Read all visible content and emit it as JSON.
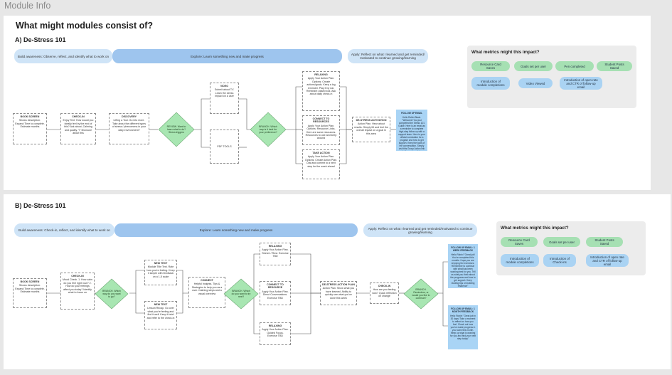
{
  "window": {
    "title": "Module Info"
  },
  "page": {
    "heading": "What might modules consist of?"
  },
  "sectionA": {
    "label": "A) De-Stress 101",
    "phases": {
      "build": "Build awareness: Observe, reflect, and identify what to work on",
      "explore": "Explore: Learn something new and make progress",
      "apply": "Apply: Reflect on what I learned and get reminded/ motivated to continue growing/learning"
    },
    "nodes": {
      "book": {
        "title": "BOOK SCREEN",
        "body": "Shows description. Expand Time to complete. Estimate months"
      },
      "checkin": {
        "title": "CHECK-IN",
        "body": "Enjoy Text. How would you ideally feel by the end of this? Ask about, Calming and quality. \"I\" Ill/unsure about this"
      },
      "doc": {
        "title": "DISCOVERY",
        "body": "Lifting a Tool. Go into more. Take about the different types of stress / phenomena in your daily environment?"
      },
      "video": {
        "title": "VIDEO",
        "body": "Submit about TV. Learn the stress impact on a user"
      },
      "placeholder": "PDF TOOLS",
      "relaxing": {
        "title": "RELAXING",
        "body": "Apply Your Action Plan. Options: Create actions/goals. Keep a log reminder. Play it by ear. Reminder-based tool. Ask about daily check-in"
      },
      "connect": {
        "title": "CONNECT TO RESOURCES",
        "body": "Apply Your Action Plan. Options: Resource Links. Here are some resources. Resources to use and keep around"
      },
      "take": {
        "title": "TAKE ACTION",
        "body": "Apply Your Action Plan. Options: Create Action Plan. Dial and commit to a next step for the week ahead"
      },
      "destress": {
        "title": "DE-STRESS ACTIVATION",
        "body": "Action Plan. Hear about results. Simply lift and feel the overall impact on a goal in this area"
      }
    },
    "diamonds": {
      "d1": "REVIEW. Want to learn what to do? Stress triggers",
      "d2": "BRANCH. Which way is it best for your preference?"
    },
    "sticky": {
      "title": "FOLLOW UP EMAIL",
      "body": "Hello Robin Black. \"Welcome! You just completed the Stress 101 Guide. Here is an email as a reminder to complete high-stay follow up with a support team. Here is your official nomination for a program and how to get support. Keep the tools of the conversation. Simply visit this Group Action link in the next week to complete more\""
    },
    "metrics": {
      "title": "What metrics might this impact?",
      "items": [
        "Resource Card Saves",
        "Goals set per user",
        "Pen completed",
        "Student Posts Saved",
        "Introduction of module completions",
        "Video Viewed",
        "Introduction of open rate and CTR of follow-up email"
      ]
    }
  },
  "sectionB": {
    "label": "B) De-Stress 101",
    "phases": {
      "build": "Build awareness: Check-in, reflect, and identify what to work on",
      "explore": "Explore: Learn something new and make progress",
      "apply": "Apply: Reflect on what I learned and get reminded/motivated to continue growing/learning"
    },
    "nodes": {
      "book": {
        "title": "BOOK SCREEN",
        "body": "Shows description. Expand Time to complete. Estimate months"
      },
      "checkin": {
        "title": "CHECK-IN",
        "body": "Mood Check. 1. How calm do you feel right now? 2. How do your feelings affect you today? Identify what to focus on"
      },
      "new1": {
        "title": "NEW TEXT",
        "body": "Module Title Text. Rate how you're feeling. Keep it simple with feedback on a 1-5 scale"
      },
      "new2": {
        "title": "NEW TEXT",
        "body": "Lesson Recap. Go over what you're feeling and find it well. Keep it brief and refer to the check-in"
      },
      "connect1": {
        "title": "CONNECT",
        "body": "Helpful Insights. Tips & Strategies to help you as a user. Calming steps and a visual overview"
      },
      "opt1": {
        "title": "RELAXING",
        "body": "Apply Your Action Plan. Stretch / Rest. Exercise TBD"
      },
      "opt2": {
        "title": "CONNECT TO RESOURCE",
        "body": "Apply Your Action Plan. Direct Conversations. Exercise TBD"
      },
      "opt3": {
        "title": "RELAXING",
        "body": "Apply Your Action Plan. Guided Focus. Exercise TBD"
      },
      "destress": {
        "title": "DE-STRESS ACTION PLAN",
        "body": "Action Plan. Show what you have learned. Ability to quickly see what you've done this week"
      },
      "checkout": {
        "title": "CHECK-IN",
        "body": "How are you feeling now? Quick reflection on change"
      }
    },
    "diamonds": {
      "d1": "BRANCH. Which way do you want to go?",
      "d2": "BRANCH. Which do you want to try next?",
      "d3": "BRANCH. Reminders, or would you like to continue?"
    },
    "stickies": [
      {
        "title": "FOLLOW UP EMAIL: 1 WEEK FEEDBACK",
        "body": "Hello Robin! \"Great job! You've completed this module. Hope you are enjoying the exercises. Remember to continue with what has been working best for you. Tell us what you think about the programs and how to get support. Keep reading tips on building resilience\""
      },
      {
        "title": "FOLLOW UP EMAIL: 1 MONTH FEEDBACK",
        "body": "Hello Robin! \"Great job in 30 days! Take a moment to reflect on how you feel. Check out how you've made progress in your calm this month. Keep up what is working for you and find your next step today\""
      }
    ],
    "metrics": {
      "title": "What metrics might this impact?",
      "items": [
        "Resource Card Saves",
        "Goals set per user",
        "Student Posts Saved",
        "Introduction of module completions",
        "Introduction of Check-ins",
        "Introduction of open rate and CTR of follow-up email"
      ]
    }
  },
  "colors": {
    "background": "#e7e7e7",
    "phaseLight": "#cfe4f7",
    "phaseMid": "#9ec5ee",
    "diamond": "#a8e6b2",
    "sticky": "#a9d4f5",
    "metricGreen": "#a6e0b3",
    "metricBlue": "#aad3f3"
  }
}
